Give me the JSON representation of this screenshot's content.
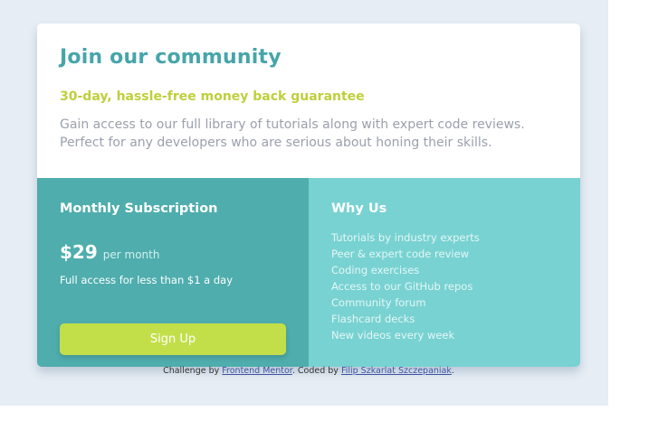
{
  "card": {
    "title": "Join our community",
    "guarantee": "30-day, hassle-free money back guarantee",
    "description": "Gain access to our full library of tutorials along with expert code reviews. Perfect for any developers who are serious about honing their skills."
  },
  "subscription": {
    "title": "Monthly Subscription",
    "price": "$29",
    "period": "per month",
    "access": "Full access for less than $1 a day",
    "signup_label": "Sign Up"
  },
  "why_us": {
    "title": "Why Us",
    "items": [
      "Tutorials by industry experts",
      "Peer & expert code review",
      "Coding exercises",
      "Access to our GitHub repos",
      "Community forum",
      "Flashcard decks",
      "New videos every week"
    ]
  },
  "attribution": {
    "prefix": "Challenge by ",
    "challenge_link": "Frontend Mentor",
    "middle": ". Coded by ",
    "author_link": "Filip Szkarlat Szczepaniak",
    "suffix": "."
  },
  "colors": {
    "title": "#46a5aa",
    "guarantee": "#bfcf3b",
    "left_panel": "#4fadad",
    "right_panel": "#78d2d2",
    "button": "#c2df4a"
  }
}
